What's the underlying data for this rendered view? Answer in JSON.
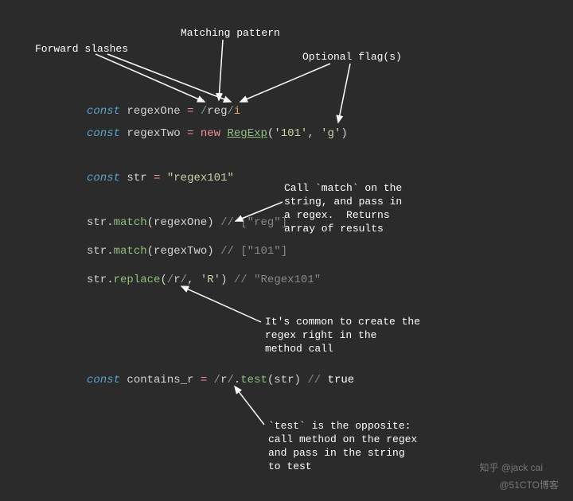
{
  "annotations": {
    "forward_slashes": "Forward slashes",
    "matching_pattern": "Matching pattern",
    "optional_flags": "Optional flag(s)",
    "match_note": "Call `match` on the\nstring, and pass in\na regex.  Returns\narray of results",
    "inline_note": "It's common to create the\nregex right in the\nmethod call",
    "test_note": "`test` is the opposite:\ncall method on the regex\nand pass in the string\nto test"
  },
  "code": {
    "kw_const": "const",
    "kw_new": "new",
    "id_regexOne": "regexOne",
    "id_regexTwo": "regexTwo",
    "id_str": "str",
    "id_contains_r": "contains_r",
    "fn_match": "match",
    "fn_replace": "replace",
    "fn_test": "test",
    "cls_RegExp": "RegExp",
    "eq": "=",
    "slash": "/",
    "pat_reg": "reg",
    "pat_r": "r",
    "flag_i": "i",
    "str_101": "'101'",
    "str_g": "'g'",
    "str_regex101": "\"regex101\"",
    "str_R": "'R'",
    "cm_reg": "// [\"reg\"]",
    "cm_101": "// [\"101\"]",
    "cm_Regex101": "// \"Regex101\"",
    "cm_true_pref": "// ",
    "cm_true": "true"
  },
  "watermark": {
    "zh": "知乎 @jack cai",
    "blog": "@51CTO博客"
  }
}
